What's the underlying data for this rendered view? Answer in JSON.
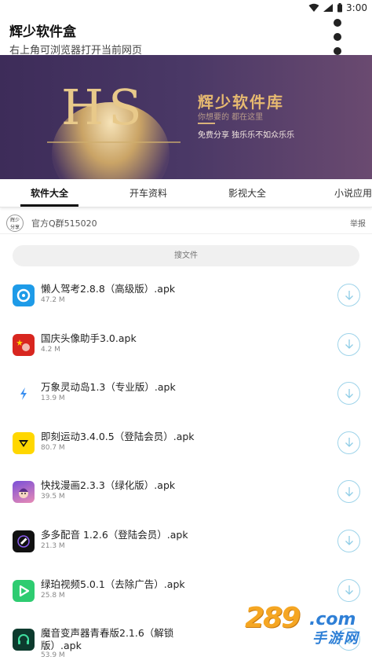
{
  "status_bar": {
    "time": "3:00"
  },
  "app_bar": {
    "title": "辉少软件盒",
    "subtitle": "右上角可浏览器打开当前网页"
  },
  "banner": {
    "logo_text": "HS",
    "title": "辉少软件库",
    "slogan": "你想要的 都在这里",
    "description": "免费分享 独乐乐不如众乐乐"
  },
  "tabs": [
    {
      "label": "软件大全",
      "active": true
    },
    {
      "label": "开车资料",
      "active": false
    },
    {
      "label": "影视大全",
      "active": false
    },
    {
      "label": "小说应用",
      "active": false
    }
  ],
  "notice": {
    "logo_line1": "辉少",
    "logo_line2": "分享",
    "text": "官方Q群515020",
    "report_label": "举报"
  },
  "search": {
    "placeholder": "搜文件"
  },
  "files": [
    {
      "name": "懒人驾考2.8.8（高级版）.apk",
      "size": "47.2 M",
      "icon": "steering-wheel-icon",
      "color": "#1e9be8"
    },
    {
      "name": "国庆头像助手3.0.apk",
      "size": "4.2 M",
      "icon": "flag-avatar-icon",
      "color": "#d8261f"
    },
    {
      "name": "万象灵动岛1.3（专业版）.apk",
      "size": "13.9 M",
      "icon": "lightning-icon",
      "color": "#3a8ff0"
    },
    {
      "name": "即刻运动3.4.0.5（登陆会员）.apk",
      "size": "80.7 M",
      "icon": "sport-icon",
      "color": "#ffd700"
    },
    {
      "name": "快找漫画2.3.3（绿化版）.apk",
      "size": "39.5 M",
      "icon": "manga-icon",
      "color": "#7a4fd8"
    },
    {
      "name": "多多配音 1.2.6（登陆会员）.apk",
      "size": "21.3 M",
      "icon": "microphone-icon",
      "color": "#111111"
    },
    {
      "name": "绿珀视频5.0.1（去除广告）.apk",
      "size": "25.8 M",
      "icon": "play-icon",
      "color": "#2ecc71"
    },
    {
      "name": "魔音变声器青春版2.1.6（解锁版）.apk",
      "size": "53.9 M",
      "icon": "headphones-icon",
      "color": "#0d3b2e"
    }
  ],
  "watermark": {
    "number": "289",
    "domain": ".com",
    "site": "手游网"
  }
}
